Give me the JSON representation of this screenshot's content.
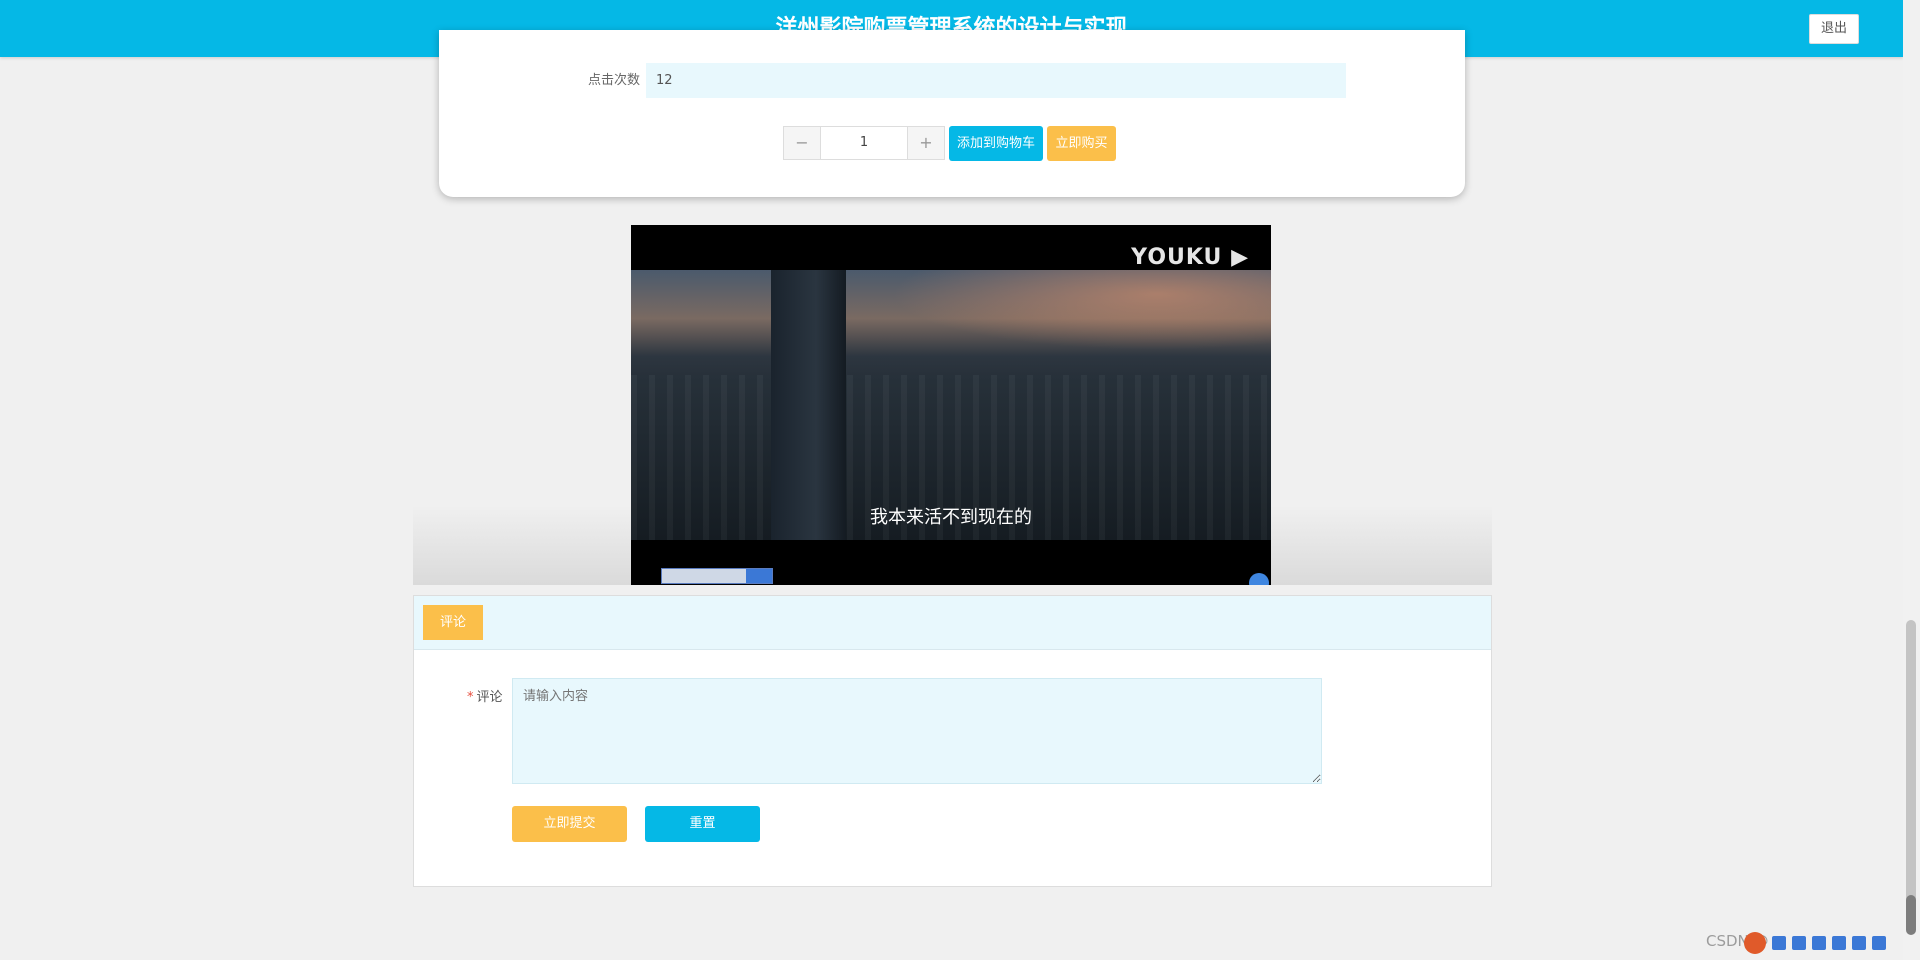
{
  "header": {
    "title": "洋州影院购票管理系统的设计与实现",
    "logout_label": "退出"
  },
  "detail": {
    "clicks_label": "点击次数",
    "clicks_value": "12",
    "quantity": "1",
    "minus_icon": "−",
    "plus_icon": "+",
    "add_to_cart_label": "添加到购物车",
    "buy_now_label": "立即购买"
  },
  "video": {
    "logo": "YOUKU ▶",
    "subtitle": "我本来活不到现在的"
  },
  "comment": {
    "tab_label": "评论",
    "field_required_mark": "*",
    "field_label": "评论",
    "placeholder": "请输入内容",
    "submit_label": "立即提交",
    "reset_label": "重置"
  },
  "watermark": "CSDN @"
}
